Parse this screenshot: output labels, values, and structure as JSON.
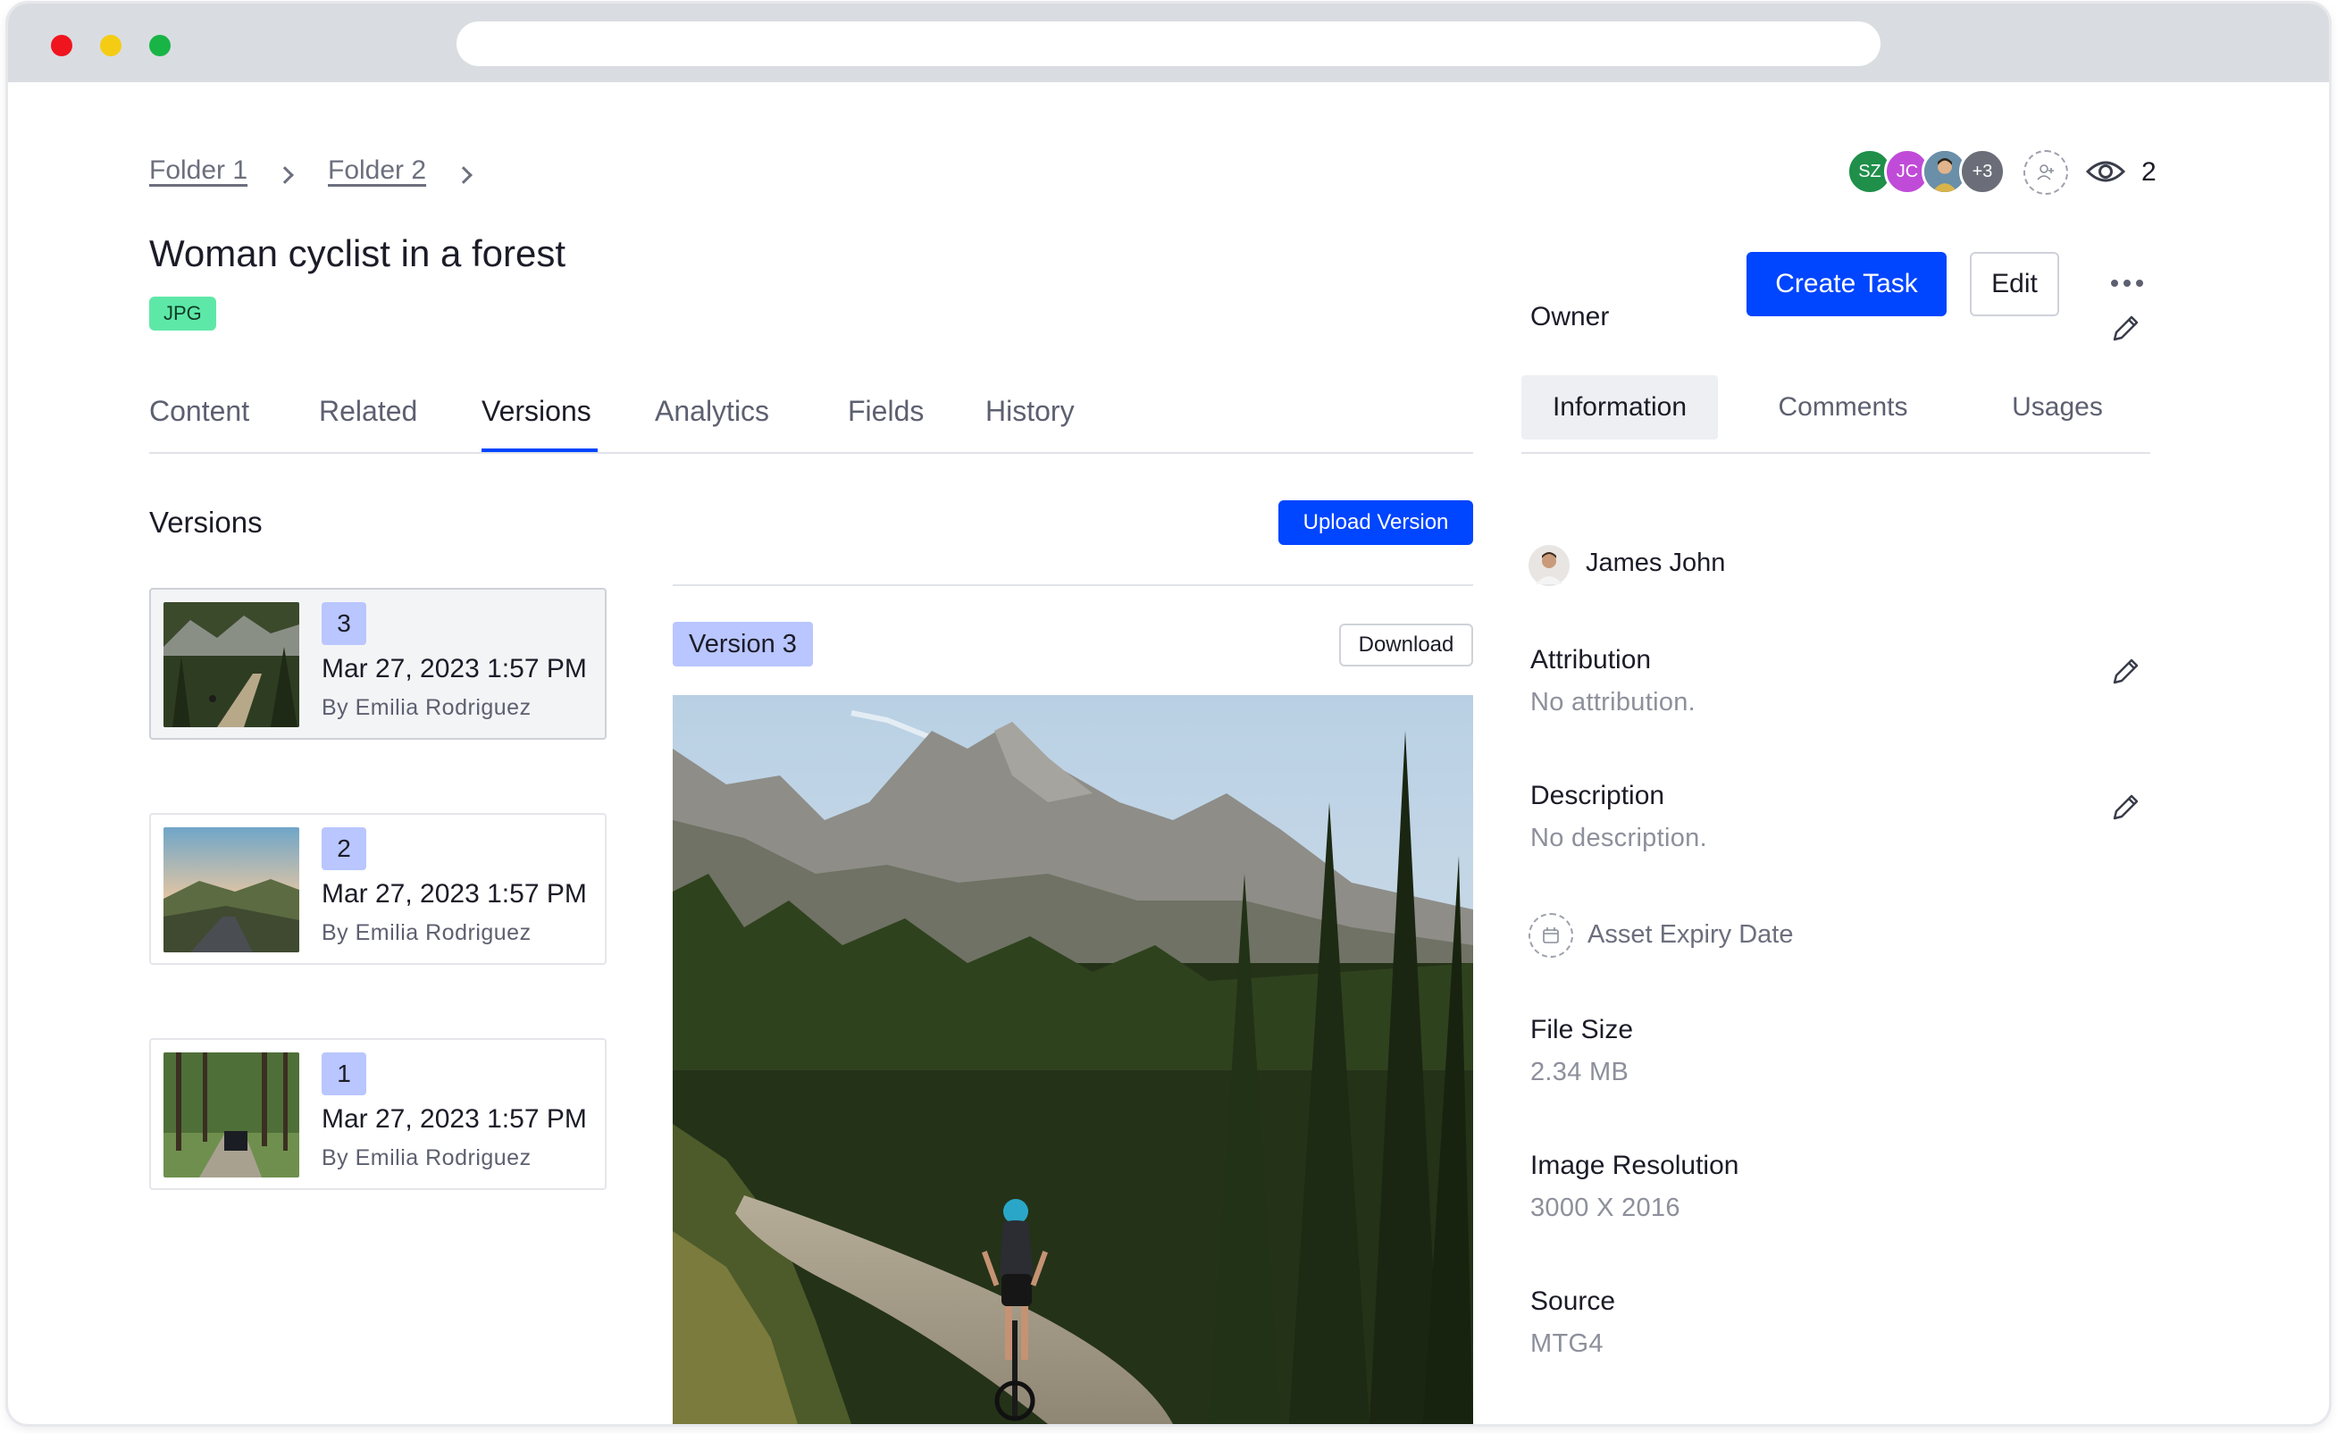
{
  "breadcrumb": [
    "Folder 1",
    "Folder 2"
  ],
  "collaborators": {
    "avatars": [
      {
        "initials": "SZ",
        "color": "#1f8f4a"
      },
      {
        "initials": "JC",
        "color": "#c04bd8"
      },
      {
        "initials": "",
        "color": "#4a6b8c"
      },
      {
        "initials": "+3",
        "color": "#6b6e78"
      }
    ],
    "viewer_count": "2"
  },
  "asset": {
    "title": "Woman cyclist in a forest",
    "format_badge": "JPG"
  },
  "actions": {
    "create_task": "Create Task",
    "edit": "Edit"
  },
  "tabs": [
    "Content",
    "Related",
    "Versions",
    "Analytics",
    "Fields",
    "History"
  ],
  "active_tab": "Versions",
  "right_tabs": [
    "Information",
    "Comments",
    "Usages"
  ],
  "active_right_tab": "Information",
  "versions_panel": {
    "title": "Versions",
    "upload_label": "Upload Version",
    "download_label": "Download",
    "selected_label": "Version 3",
    "items": [
      {
        "number": "3",
        "date": "Mar 27, 2023 1:57 PM",
        "by": "By Emilia Rodriguez"
      },
      {
        "number": "2",
        "date": "Mar 27, 2023 1:57 PM",
        "by": "By Emilia Rodriguez"
      },
      {
        "number": "1",
        "date": "Mar 27, 2023 1:57 PM",
        "by": "By Emilia Rodriguez"
      }
    ]
  },
  "info": {
    "owner_label": "Owner",
    "owner_name": "James John",
    "attribution_label": "Attribution",
    "attribution_value": "No attribution.",
    "description_label": "Description",
    "description_value": "No description.",
    "expiry_label": "Asset Expiry Date",
    "file_size_label": "File Size",
    "file_size_value": "2.34 MB",
    "resolution_label": "Image Resolution",
    "resolution_value": "3000 X 2016",
    "source_label": "Source",
    "source_value": "MTG4"
  },
  "colors": {
    "accent": "#0045ff",
    "badge_green": "#5ee8a8",
    "version_badge": "#b9c6ff"
  }
}
